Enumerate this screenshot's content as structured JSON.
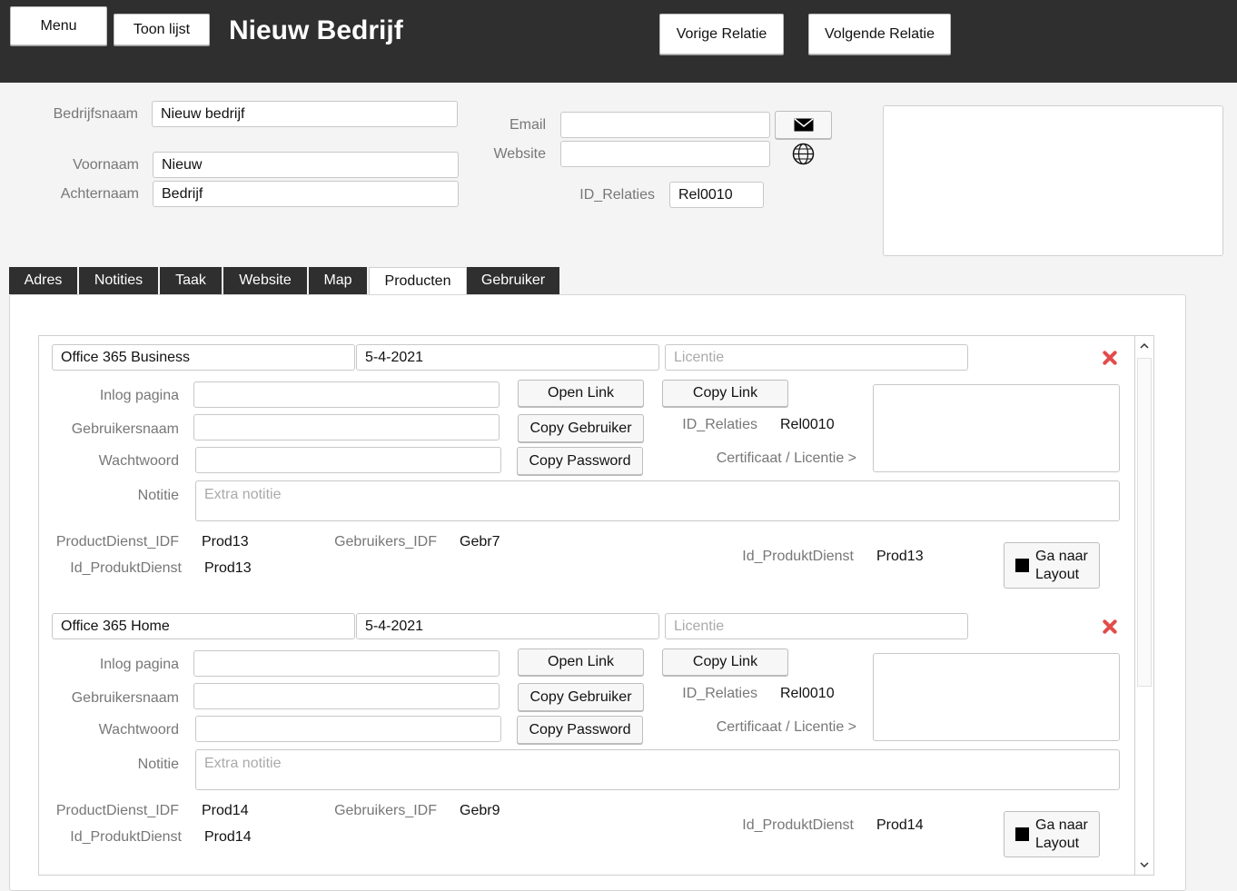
{
  "header": {
    "menu_label": "Menu",
    "list_label": "Toon lijst",
    "title": "Nieuw Bedrijf",
    "prev_label": "Vorige Relatie",
    "next_label": "Volgende Relatie"
  },
  "form": {
    "company_label": "Bedrijfsnaam",
    "company_value": "Nieuw bedrijf",
    "firstname_label": "Voornaam",
    "firstname_value": "Nieuw",
    "lastname_label": "Achternaam",
    "lastname_value": "Bedrijf",
    "email_label": "Email",
    "email_value": "",
    "website_label": "Website",
    "website_value": "",
    "id_label": "ID_Relaties",
    "id_value": "Rel0010"
  },
  "tabs": [
    "Adres",
    "Notities",
    "Taak",
    "Website",
    "Map",
    "Producten",
    "Gebruiker"
  ],
  "active_tab": "Producten",
  "products": [
    {
      "name": "Office 365 Business",
      "date": "5-4-2021",
      "license_placeholder": "Licentie",
      "login_label": "Inlog pagina",
      "user_label": "Gebruikersnaam",
      "password_label": "Wachtwoord",
      "note_label": "Notitie",
      "note_placeholder": "Extra notitie",
      "open_link": "Open Link",
      "copy_link": "Copy Link",
      "copy_user": "Copy Gebruiker",
      "copy_password": "Copy Password",
      "id_relaties_label": "ID_Relaties",
      "id_relaties_value": "Rel0010",
      "cert_label": "Certificaat / Licentie >",
      "pd_idf_label": "ProductDienst_IDF",
      "pd_idf_value": "Prod13",
      "gebr_idf_label": "Gebruikers_IDF",
      "gebr_idf_value": "Gebr7",
      "id_pd_label": "Id_ProduktDienst",
      "id_pd_value": "Prod13",
      "id_pd_label2": "Id_ProduktDienst",
      "id_pd_value2": "Prod13",
      "layout_label": "Ga naar Layout"
    },
    {
      "name": "Office 365 Home",
      "date": "5-4-2021",
      "license_placeholder": "Licentie",
      "login_label": "Inlog pagina",
      "user_label": "Gebruikersnaam",
      "password_label": "Wachtwoord",
      "note_label": "Notitie",
      "note_placeholder": "Extra notitie",
      "open_link": "Open Link",
      "copy_link": "Copy Link",
      "copy_user": "Copy Gebruiker",
      "copy_password": "Copy Password",
      "id_relaties_label": "ID_Relaties",
      "id_relaties_value": "Rel0010",
      "cert_label": "Certificaat / Licentie >",
      "pd_idf_label": "ProductDienst_IDF",
      "pd_idf_value": "Prod14",
      "gebr_idf_label": "Gebruikers_IDF",
      "gebr_idf_value": "Gebr9",
      "id_pd_label": "Id_ProduktDienst",
      "id_pd_value": "Prod14",
      "id_pd_label2": "Id_ProduktDienst",
      "id_pd_value2": "Prod14",
      "layout_label": "Ga naar Layout"
    }
  ]
}
